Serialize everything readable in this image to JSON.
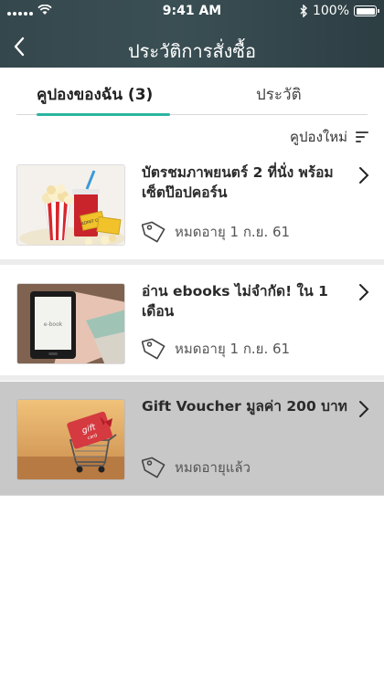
{
  "status": {
    "time": "9:41 AM",
    "battery": "100%",
    "battery_level": 1.0
  },
  "header": {
    "title": "ประวัติการสั่งซื้อ"
  },
  "tabs": [
    {
      "label": "คูปองของฉัน (3)",
      "active": true
    },
    {
      "label": "ประวัติ",
      "active": false
    }
  ],
  "sort": {
    "label": "คูปองใหม่"
  },
  "coupons": [
    {
      "title": "บัตรชมภาพยนตร์ 2 ที่นั่ง พร้อมเซ็ตป๊อปคอร์น",
      "expiry": "หมดอายุ 1 ก.ย. 61",
      "image": "popcorn-tickets",
      "ticket_text": "ADMIT ONE"
    },
    {
      "title": "อ่าน ebooks ไม่จำกัด! ใน 1 เดือน",
      "expiry": "หมดอายุ 1 ก.ย. 61",
      "image": "ebook-reader",
      "screen_text": "e-book"
    },
    {
      "title": "Gift Voucher มูลค่า 200 บาท",
      "expiry": "หมดอายุแล้ว",
      "image": "gift-cart",
      "card_text": "gift",
      "card_sub": "card",
      "expired": true
    }
  ],
  "colors": {
    "accent": "#2ab5a0",
    "header": "#3a4f54",
    "expired_bg": "#c8c8c8"
  }
}
